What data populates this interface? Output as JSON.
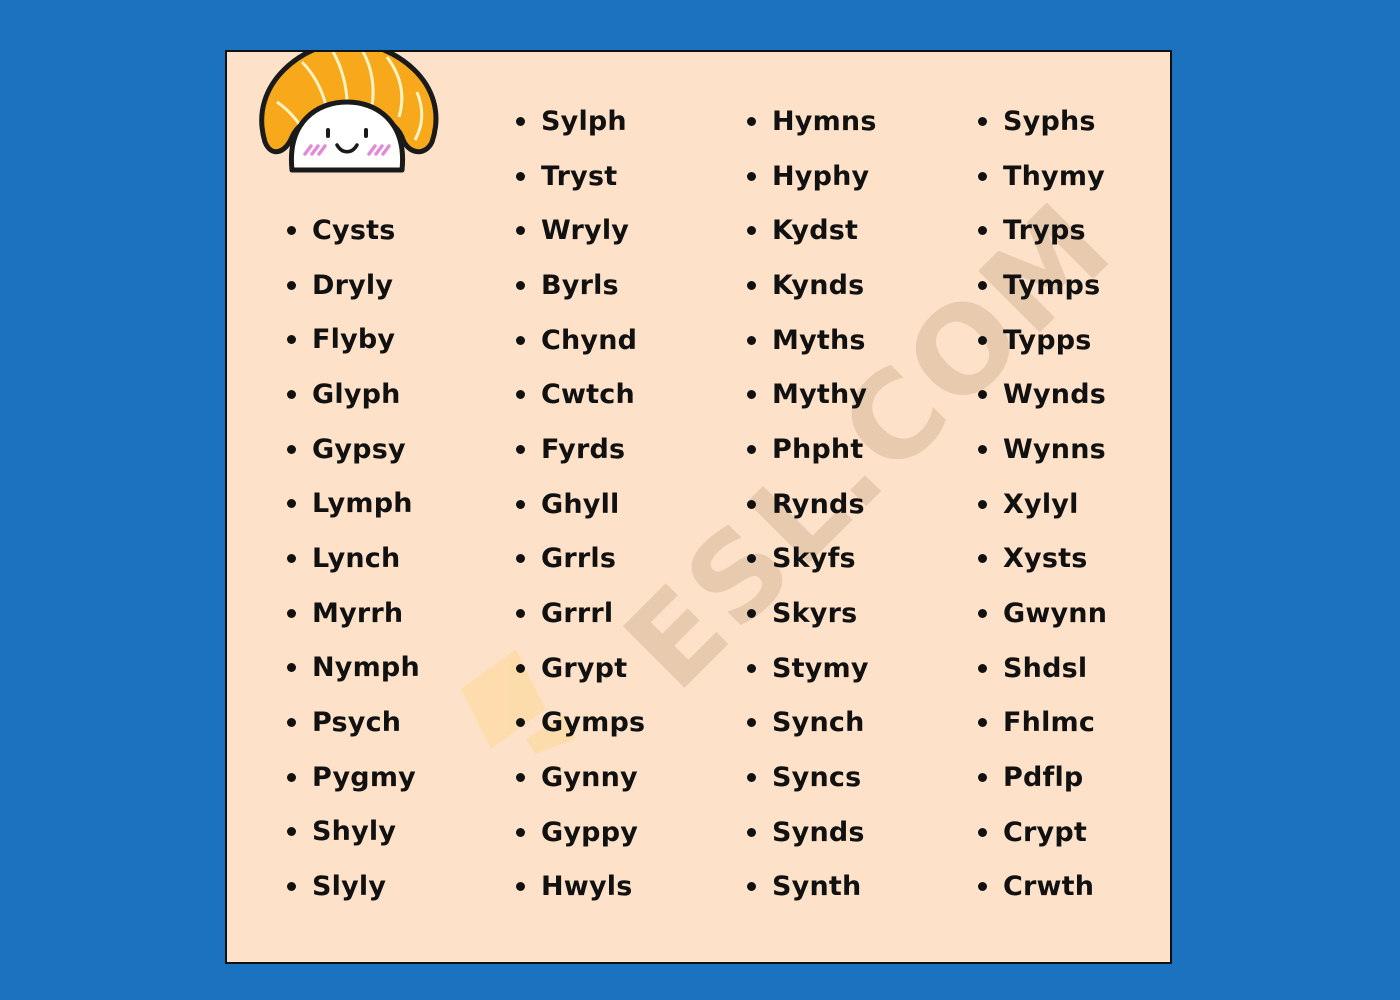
{
  "colors": {
    "background": "#1b73bf",
    "card": "#fde1c8",
    "text": "#111111",
    "salmon": "#f7a91b",
    "blush": "#e58bd6"
  },
  "mascot": {
    "icon": "sushi-mascot-icon"
  },
  "watermark": {
    "text": "ESL.COM"
  },
  "columns": [
    {
      "words": [
        "Cysts",
        "Dryly",
        "Flyby",
        "Glyph",
        "Gypsy",
        "Lymph",
        "Lynch",
        "Myrrh",
        "Nymph",
        "Psych",
        "Pygmy",
        "Shyly",
        "Slyly"
      ]
    },
    {
      "words": [
        "Sylph",
        "Tryst",
        "Wryly",
        "Byrls",
        "Chynd",
        "Cwtch",
        "Fyrds",
        "Ghyll",
        "Grrls",
        "Grrrl",
        "Grypt",
        "Gymps",
        "Gynny",
        "Gyppy",
        "Hwyls"
      ]
    },
    {
      "words": [
        "Hymns",
        "Hyphy",
        "Kydst",
        "Kynds",
        "Myths",
        "Mythy",
        "Phpht",
        "Rynds",
        "Skyfs",
        "Skyrs",
        "Stymy",
        "Synch",
        "Syncs",
        "Synds",
        "Synth"
      ]
    },
    {
      "words": [
        "Syphs",
        "Thymy",
        "Tryps",
        "Tymps",
        "Typps",
        "Wynds",
        "Wynns",
        "Xylyl",
        "Xysts",
        "Gwynn",
        "Shdsl",
        "Fhlmc",
        "Pdflp",
        "Crypt",
        "Crwth"
      ]
    }
  ]
}
